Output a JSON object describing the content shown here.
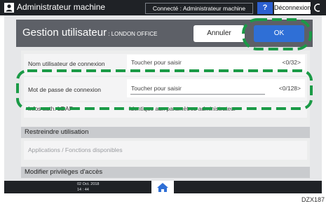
{
  "topbar": {
    "title": "Administrateur machine",
    "connection": "Connecté : Administrateur machine",
    "help_label": "?",
    "logout_label": "Déconnexion"
  },
  "panel": {
    "title": "Gestion utilisateur",
    "subtitle": " : LONDON OFFICE",
    "cancel_label": "Annuler",
    "ok_label": "OK"
  },
  "rows": [
    {
      "label": "Nom utilisateur de connexion",
      "placeholder": "Toucher pour saisir",
      "counter": "<0/32>"
    },
    {
      "label": "Mot de passe de connexion",
      "placeholder": "Toucher pour saisir",
      "counter": "<0/128>"
    },
    {
      "label": "Infos auth. LDAP",
      "value": "Identique aux paramètres administrateur"
    }
  ],
  "sections": {
    "restrict_title": "Restreindre utilisation",
    "apps_item": "Applications / Fonctions disponibles",
    "privileges_title": "Modifier privilèges d'accès"
  },
  "statusbar": {
    "date": "02 Oct. 2018",
    "time": "14 : 44"
  },
  "caption": "DZX187",
  "colors": {
    "accent": "#2f6fd6",
    "highlight": "#1a9a46",
    "bar": "#1f2226"
  },
  "icons": [
    "user-icon",
    "power-icon",
    "home-icon"
  ]
}
